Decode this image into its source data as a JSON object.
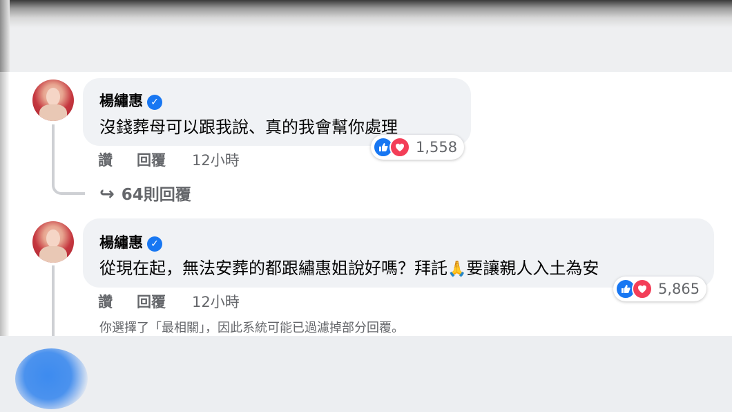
{
  "comments": [
    {
      "author": "楊繡惠",
      "text": "沒錢葬母可以跟我說、真的我會幫你處理",
      "reaction_count": "1,558",
      "actions": {
        "like": "讚",
        "reply": "回覆",
        "time": "12小時"
      },
      "replies_link": "64則回覆"
    },
    {
      "author": "楊繡惠",
      "text_before_emoji": "從現在起，無法安葬的都跟繡惠姐說好嗎？拜託",
      "emoji": "🙏",
      "text_after_emoji": "要讓親人入土為安",
      "reaction_count": "5,865",
      "actions": {
        "like": "讚",
        "reply": "回覆",
        "time": "12小時"
      }
    }
  ],
  "filter_note": "你選擇了「最相關」，因此系統可能已過濾掉部分回覆。",
  "icons": {
    "verified": "verified-badge-icon",
    "like": "like-reaction-icon",
    "love": "love-reaction-icon",
    "reply_arrow": "reply-arrow-icon"
  },
  "colors": {
    "bubble": "#f0f2f5",
    "verified": "#1877f2",
    "like": "#1877f2",
    "love": "#f33e58",
    "secondary_text": "#65676b"
  }
}
